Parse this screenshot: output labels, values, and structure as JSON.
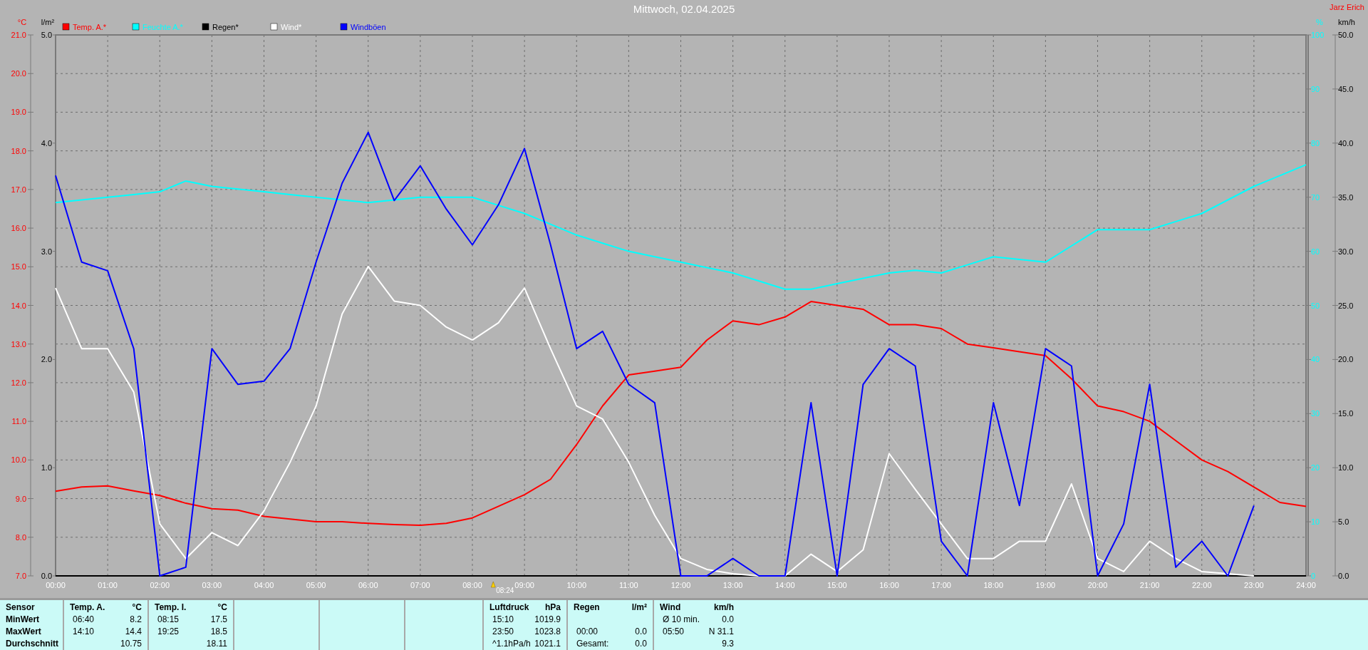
{
  "header": {
    "author": "Jarz Erich"
  },
  "rain_axis": {
    "unit": "l/m²",
    "ticks": [
      "5.0",
      "4.0",
      "3.0",
      "2.0",
      "1.0",
      "0.0"
    ]
  },
  "chart_data": {
    "type": "line",
    "title": "Mittwoch, 02.04.2025",
    "x": [
      0,
      0.5,
      1,
      1.5,
      2,
      2.5,
      3,
      3.5,
      4,
      4.5,
      5,
      5.5,
      6,
      6.5,
      7,
      7.5,
      8,
      8.5,
      9,
      9.5,
      10,
      10.5,
      11,
      11.5,
      12,
      12.5,
      13,
      13.5,
      14,
      14.5,
      15,
      15.5,
      16,
      16.5,
      17,
      17.5,
      18,
      18.5,
      19,
      19.5,
      20,
      20.5,
      21,
      21.5,
      22,
      22.5,
      23,
      23.5,
      24
    ],
    "xlim": [
      0,
      24
    ],
    "xticks": [
      {
        "value": 0,
        "label": "00:00"
      },
      {
        "value": 1,
        "label": "01:00"
      },
      {
        "value": 2,
        "label": "02:00"
      },
      {
        "value": 3,
        "label": "03:00"
      },
      {
        "value": 4,
        "label": "04:00"
      },
      {
        "value": 5,
        "label": "05:00"
      },
      {
        "value": 6,
        "label": "06:00"
      },
      {
        "value": 7,
        "label": "07:00"
      },
      {
        "value": 8,
        "label": "08:00"
      },
      {
        "value": 9,
        "label": "09:00"
      },
      {
        "value": 10,
        "label": "10:00"
      },
      {
        "value": 11,
        "label": "11:00"
      },
      {
        "value": 12,
        "label": "12:00"
      },
      {
        "value": 13,
        "label": "13:00"
      },
      {
        "value": 14,
        "label": "14:00"
      },
      {
        "value": 15,
        "label": "15:00"
      },
      {
        "value": 16,
        "label": "16:00"
      },
      {
        "value": 17,
        "label": "17:00"
      },
      {
        "value": 18,
        "label": "18:00"
      },
      {
        "value": 19,
        "label": "19:00"
      },
      {
        "value": 20,
        "label": "20:00"
      },
      {
        "value": 21,
        "label": "21:00"
      },
      {
        "value": 22,
        "label": "22:00"
      },
      {
        "value": 23,
        "label": "23:00"
      },
      {
        "value": 24,
        "label": "24:00"
      }
    ],
    "ylabel": "°C",
    "ylim": [
      7,
      21
    ],
    "yticks": [
      {
        "value": 7,
        "label": "7.0"
      },
      {
        "value": 8,
        "label": "8.0"
      },
      {
        "value": 9,
        "label": "9.0"
      },
      {
        "value": 10,
        "label": "10.0"
      },
      {
        "value": 11,
        "label": "11.0"
      },
      {
        "value": 12,
        "label": "12.0"
      },
      {
        "value": 13,
        "label": "13.0"
      },
      {
        "value": 14,
        "label": "14.0"
      },
      {
        "value": 15,
        "label": "15.0"
      },
      {
        "value": 16,
        "label": "16.0"
      },
      {
        "value": 17,
        "label": "17.0"
      },
      {
        "value": 18,
        "label": "18.0"
      },
      {
        "value": 19,
        "label": "19.0"
      },
      {
        "value": 20,
        "label": "20.0"
      },
      {
        "value": 21,
        "label": "21.0"
      }
    ],
    "y2label": "km/h",
    "y2lim": [
      0,
      50
    ],
    "y2ticks": [
      {
        "value": 0,
        "label": "0.0"
      },
      {
        "value": 5,
        "label": "5.0"
      },
      {
        "value": 10,
        "label": "10.0"
      },
      {
        "value": 15,
        "label": "15.0"
      },
      {
        "value": 20,
        "label": "20.0"
      },
      {
        "value": 25,
        "label": "25.0"
      },
      {
        "value": 30,
        "label": "30.0"
      },
      {
        "value": 35,
        "label": "35.0"
      },
      {
        "value": 40,
        "label": "40.0"
      },
      {
        "value": 45,
        "label": "45.0"
      },
      {
        "value": 50,
        "label": "50.0"
      }
    ],
    "y3label": "%",
    "y3lim": [
      0,
      100
    ],
    "y3ticks": [
      0,
      10,
      20,
      30,
      40,
      50,
      60,
      70,
      80,
      90,
      100
    ],
    "series": [
      {
        "name": "Temp. A.*",
        "color": "#ff0000",
        "values": [
          9.19,
          9.3,
          9.33,
          9.2,
          9.08,
          8.88,
          8.74,
          8.7,
          8.54,
          8.47,
          8.4,
          8.4,
          8.36,
          8.33,
          8.31,
          8.36,
          8.5,
          8.8,
          9.1,
          9.5,
          10.4,
          11.4,
          12.2,
          12.3,
          12.4,
          13.1,
          13.6,
          13.5,
          13.7,
          14.1,
          14.0,
          13.9,
          13.5,
          13.5,
          13.4,
          13.0,
          12.9,
          12.8,
          12.7,
          12.1,
          11.4,
          11.25,
          11.0,
          10.5,
          10.0,
          9.7,
          9.3,
          8.9,
          8.8
        ]
      },
      {
        "name": "Feuchte A.*",
        "color": "#00ffff",
        "axis": "y3",
        "values": [
          69,
          69.5,
          70,
          70.5,
          71,
          73,
          72,
          71.5,
          71,
          70.5,
          70,
          69.5,
          69,
          69.5,
          70,
          70,
          70,
          68.5,
          67,
          65,
          63,
          61.5,
          60,
          59,
          58,
          57,
          56,
          54.5,
          53,
          53,
          54,
          55,
          56,
          56.5,
          56,
          57.5,
          59,
          58.5,
          58,
          61,
          64,
          64,
          64,
          65.5,
          67,
          69.5,
          72,
          74,
          76
        ]
      },
      {
        "name": "Regen*",
        "color": "#000000",
        "axis": "y2",
        "values": [
          0,
          0,
          0,
          0,
          0,
          0,
          0,
          0,
          0,
          0,
          0,
          0,
          0,
          0,
          0,
          0,
          0,
          0,
          0,
          0,
          0,
          0,
          0,
          0,
          0,
          0,
          0,
          0,
          0,
          0,
          0,
          0,
          0,
          0,
          0,
          0,
          0,
          0,
          0,
          0,
          0,
          0,
          0,
          0,
          0,
          0,
          0,
          0,
          0
        ]
      },
      {
        "name": "Wind*",
        "color": "#ffffff",
        "axis": "y2",
        "values": [
          26.6,
          21,
          21,
          17,
          4.8,
          1.6,
          4,
          2.8,
          6,
          10.5,
          15.7,
          24.2,
          28.6,
          25.4,
          25,
          23,
          21.8,
          23.4,
          26.6,
          21,
          15.7,
          14.5,
          10.5,
          5.6,
          1.6,
          0.6,
          0.2,
          0,
          0,
          2,
          0.4,
          2.4,
          11.3,
          8,
          4.8,
          1.6,
          1.6,
          3.2,
          3.2,
          8.5,
          1.6,
          0.4,
          3.2,
          1.6,
          0.4,
          0.2,
          0,
          null,
          null
        ]
      },
      {
        "name": "Windböen",
        "color": "#0000ff",
        "axis": "y2",
        "values": [
          37,
          29,
          28.2,
          21,
          0,
          0.8,
          21,
          17.7,
          18,
          21,
          29,
          36.3,
          41,
          34.7,
          37.9,
          33.9,
          30.6,
          34.3,
          39.5,
          30.6,
          21,
          22.6,
          17.7,
          16,
          0,
          0,
          1.6,
          0,
          0,
          16,
          0,
          17.7,
          21,
          19.4,
          3.2,
          0,
          16,
          6.5,
          21,
          19.4,
          0,
          4.8,
          17.7,
          0.8,
          3.2,
          0,
          6.5,
          null,
          null
        ]
      }
    ],
    "annotations": [
      "08:24"
    ],
    "grid": true,
    "legend": "top-left"
  },
  "stats_table": [
    {
      "kind": "labels",
      "rows": [
        "Sensor",
        "MinWert",
        "MaxWert",
        "Durchschnitt"
      ]
    },
    {
      "kind": "sensor",
      "name": "Temp. A.",
      "unit": "°C",
      "rows": [
        {
          "time": "06:40",
          "value": "8.2"
        },
        {
          "time": "14:10",
          "value": "14.4"
        },
        {
          "value": "10.75"
        }
      ]
    },
    {
      "kind": "sensor",
      "name": "Temp. I.",
      "unit": "°C",
      "rows": [
        {
          "time": "08:15",
          "value": "17.5"
        },
        {
          "time": "19:25",
          "value": "18.5"
        },
        {
          "value": "18.11"
        }
      ]
    },
    {
      "kind": "blank"
    },
    {
      "kind": "blank"
    },
    {
      "kind": "blank"
    },
    {
      "kind": "sensor",
      "name": "Luftdruck",
      "unit": "hPa",
      "rows": [
        {
          "time": "15:10",
          "value": "1019.9"
        },
        {
          "time": "23:50",
          "value": "1023.8"
        },
        {
          "time": "^1.1hPa/h",
          "value": "1021.1"
        }
      ]
    },
    {
      "kind": "sensor",
      "name": "Regen",
      "unit": "l/m²",
      "rows": [
        {},
        {
          "time": "00:00",
          "value": "0.0"
        },
        {
          "time": "Gesamt:",
          "value": "0.0"
        }
      ]
    },
    {
      "kind": "sensor",
      "name": "Wind",
      "unit": "km/h",
      "rows": [
        {
          "time": "Ø 10 min.",
          "value": "0.0"
        },
        {
          "time": "05:50",
          "value": "N 31.1"
        },
        {
          "value": "9.3"
        }
      ]
    }
  ]
}
